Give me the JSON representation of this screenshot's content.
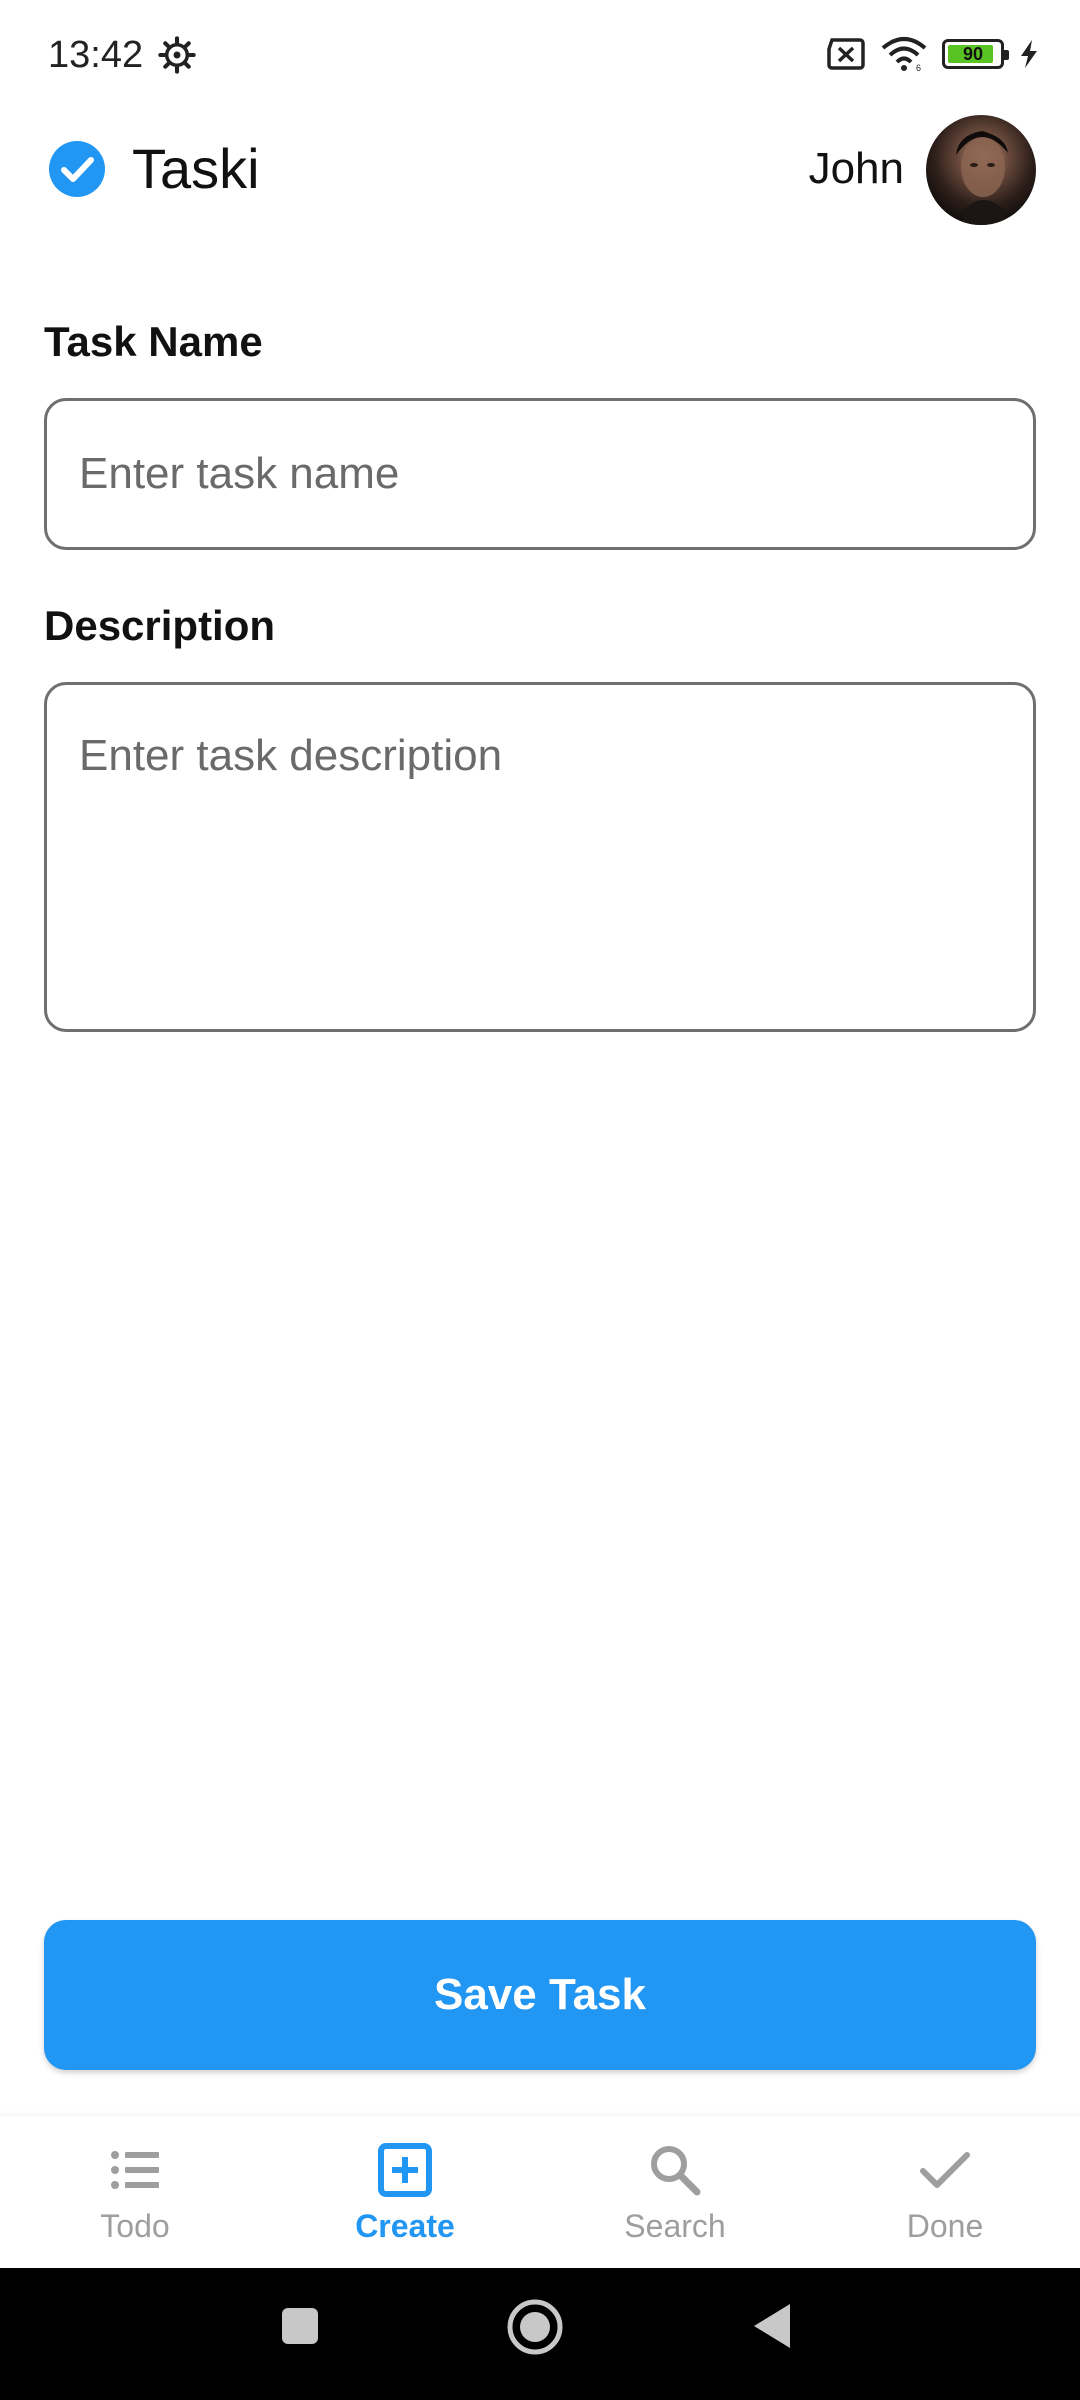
{
  "status_bar": {
    "time": "13:42",
    "battery_level": "90",
    "icons": [
      "settings-gear-icon",
      "sim-no-signal-icon",
      "wifi-icon",
      "battery-icon",
      "charging-bolt-icon"
    ]
  },
  "header": {
    "app_title": "Taski",
    "user_name": "John",
    "brand_icon": "check-circle-icon",
    "accent_color": "#2196f3"
  },
  "form": {
    "task_name_label": "Task Name",
    "task_name_placeholder": "Enter task name",
    "task_name_value": "",
    "description_label": "Description",
    "description_placeholder": "Enter task description",
    "description_value": "",
    "save_label": "Save Task"
  },
  "bottom_nav": {
    "items": [
      {
        "label": "Todo",
        "icon": "list-icon",
        "active": false
      },
      {
        "label": "Create",
        "icon": "add-box-icon",
        "active": true
      },
      {
        "label": "Search",
        "icon": "search-icon",
        "active": false
      },
      {
        "label": "Done",
        "icon": "check-icon",
        "active": false
      }
    ]
  },
  "system_nav": {
    "icons": [
      "recents-square-icon",
      "home-circle-icon",
      "back-triangle-icon"
    ]
  }
}
